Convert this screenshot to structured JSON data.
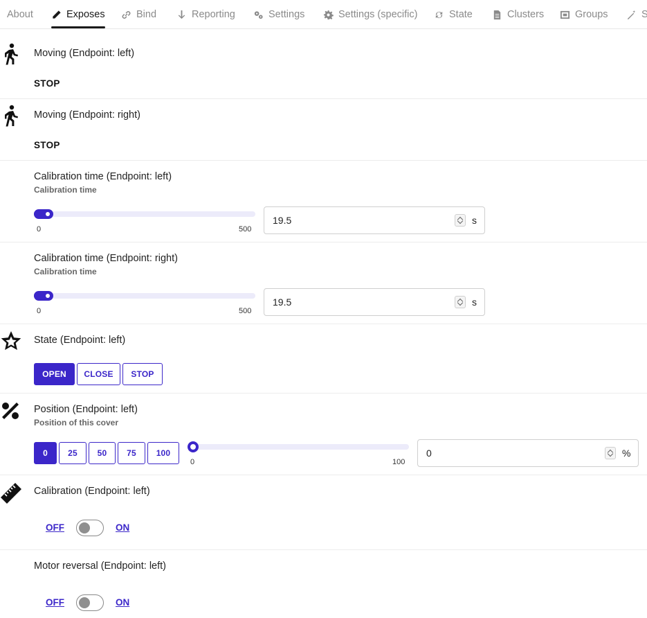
{
  "tabs": [
    {
      "label": "About",
      "icon": "info-icon"
    },
    {
      "label": "Exposes",
      "icon": "pencil-icon",
      "active": true
    },
    {
      "label": "Bind",
      "icon": "link-icon"
    },
    {
      "label": "Reporting",
      "icon": "arrow-down-icon"
    },
    {
      "label": "Settings",
      "icon": "gears-icon"
    },
    {
      "label": "Settings (specific)",
      "icon": "gear-icon"
    },
    {
      "label": "State",
      "icon": "refresh-icon"
    },
    {
      "label": "Clusters",
      "icon": "document-icon"
    },
    {
      "label": "Groups",
      "icon": "group-icon"
    },
    {
      "label": "S",
      "icon": "wand-icon"
    }
  ],
  "moving_left": {
    "label": "Moving (Endpoint: left)",
    "value": "STOP"
  },
  "moving_right": {
    "label": "Moving (Endpoint: right)",
    "value": "STOP"
  },
  "calib_time_left": {
    "label": "Calibration time (Endpoint: left)",
    "description": "Calibration time",
    "min": "0",
    "max": "500",
    "value": "19.5",
    "unit": "s"
  },
  "calib_time_right": {
    "label": "Calibration time (Endpoint: right)",
    "description": "Calibration time",
    "min": "0",
    "max": "500",
    "value": "19.5",
    "unit": "s"
  },
  "state_left": {
    "label": "State (Endpoint: left)",
    "options": [
      "OPEN",
      "CLOSE",
      "STOP"
    ],
    "selected": "OPEN"
  },
  "position_left": {
    "label": "Position (Endpoint: left)",
    "description": "Position of this cover",
    "presets": [
      "0",
      "25",
      "50",
      "75",
      "100"
    ],
    "selected": "0",
    "min": "0",
    "max": "100",
    "value": "0",
    "unit": "%"
  },
  "calibration_left": {
    "label": "Calibration (Endpoint: left)",
    "off": "OFF",
    "on": "ON",
    "state": "OFF"
  },
  "motor_reversal_left": {
    "label": "Motor reversal (Endpoint: left)",
    "off": "OFF",
    "on": "ON",
    "state": "OFF"
  },
  "colors": {
    "accent": "#3b26c9",
    "track": "#ecebfa"
  }
}
